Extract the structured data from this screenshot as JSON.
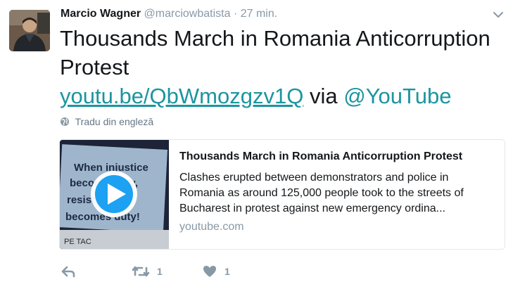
{
  "tweet": {
    "author_name": "Marcio Wagner",
    "author_handle": "@marciowbatista",
    "separator": "·",
    "time": "27 min.",
    "text_plain": "Thousands March in Romania Anticorruption Protest",
    "link_text": "youtu.be/QbWmozgzv1Q",
    "via_text": "via",
    "mention_text": "@YouTube",
    "translate_label": "Tradu din engleză"
  },
  "card": {
    "title": "Thousands March in Romania Anticorruption Protest",
    "description": "Clashes erupted between demonstrators and police in Romania as around 125,000 people took to the streets of Bucharest in protest against new emergency ordina...",
    "domain": "youtube.com",
    "thumbnail_sign_lines": [
      "When injustice",
      "becomes law,",
      "resistance",
      "becomes duty!"
    ],
    "thumbnail_footer": "PE TAC"
  },
  "actions": {
    "reply_count": "",
    "retweet_count": "1",
    "like_count": "1"
  },
  "colors": {
    "link": "#1b95a0",
    "muted": "#8899a6",
    "border": "#e1e8ed"
  }
}
